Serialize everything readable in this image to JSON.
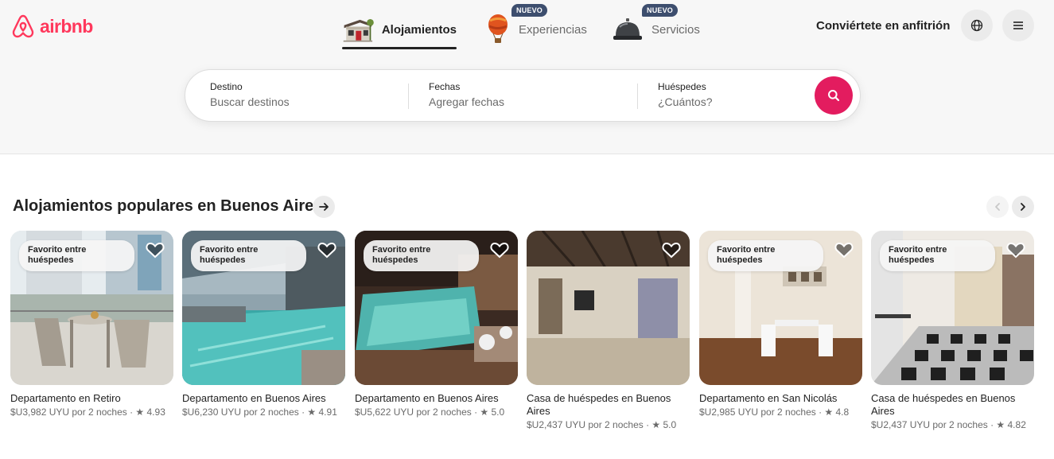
{
  "brand": {
    "name": "airbnb",
    "color": "#ff385c"
  },
  "nav": {
    "tabs": [
      {
        "label": "Alojamientos",
        "icon": "house-icon",
        "active": true
      },
      {
        "label": "Experiencias",
        "icon": "hot-air-balloon-icon",
        "badge": "NUEVO"
      },
      {
        "label": "Servicios",
        "icon": "service-bell-icon",
        "badge": "NUEVO"
      }
    ],
    "host_link": "Conviértete en anfitrión",
    "globe_icon": "globe-icon",
    "menu_icon": "hamburger-menu-icon"
  },
  "search": {
    "destination": {
      "label": "Destino",
      "placeholder": "Buscar destinos"
    },
    "dates": {
      "label": "Fechas",
      "placeholder": "Agregar fechas"
    },
    "guests": {
      "label": "Huéspedes",
      "placeholder": "¿Cuántos?"
    },
    "button_icon": "search-icon",
    "accent": "#e31c5f"
  },
  "section": {
    "title": "Alojamientos populares en Buenos Aires"
  },
  "listings": [
    {
      "title": "Departamento en Retiro",
      "meta": "$U3,982 UYU por 2 noches · ★ 4.93",
      "badge": "Favorito entre huéspedes"
    },
    {
      "title": "Departamento en Buenos Aires",
      "meta": "$U6,230 UYU por 2 noches · ★ 4.91",
      "badge": "Favorito entre huéspedes"
    },
    {
      "title": "Departamento en Buenos Aires",
      "meta": "$U5,622 UYU por 2 noches · ★ 5.0",
      "badge": "Favorito entre huéspedes"
    },
    {
      "title": "Casa de huéspedes en Buenos Aires",
      "meta": "$U2,437 UYU por 2 noches · ★ 5.0"
    },
    {
      "title": "Departamento en San Nicolás",
      "meta": "$U2,985 UYU por 2 noches · ★ 4.8",
      "badge": "Favorito entre huéspedes"
    },
    {
      "title": "Casa de huéspedes en Buenos Aires",
      "meta": "$U2,437 UYU por 2 noches · ★ 4.82",
      "badge": "Favorito entre huéspedes"
    }
  ]
}
